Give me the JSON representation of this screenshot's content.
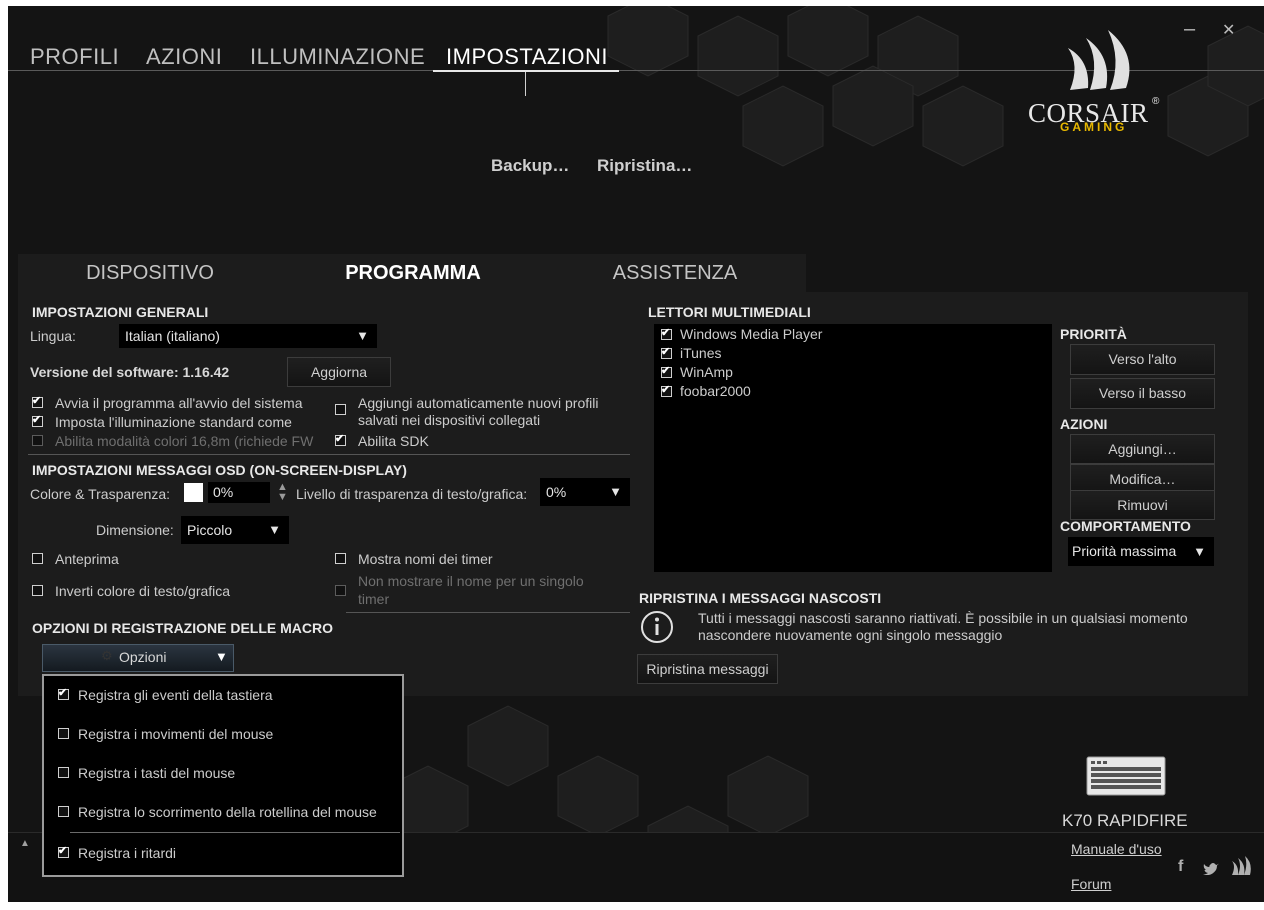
{
  "nav": {
    "tabs": [
      "PROFILI",
      "AZIONI",
      "ILLUMINAZIONE",
      "IMPOSTAZIONI"
    ],
    "minimize": "–",
    "close": "✕"
  },
  "brand": {
    "name": "CORSAIR",
    "sub": "GAMING",
    "mark": "®"
  },
  "header": {
    "backup": "Backup…",
    "restore": "Ripristina…"
  },
  "subtabs": [
    "DISPOSITIVO",
    "PROGRAMMA",
    "ASSISTENZA"
  ],
  "general": {
    "title": "IMPOSTAZIONI GENERALI",
    "language_label": "Lingua:",
    "language_value": "Italian (italiano)",
    "version_label": "Versione del software: 1.16.42",
    "update_button": "Aggiorna",
    "options": [
      {
        "label": "Avvia il programma all'avvio del sistema",
        "checked": true,
        "enabled": true
      },
      {
        "label": "Imposta l'illuminazione standard come",
        "checked": true,
        "enabled": true
      },
      {
        "label": "Abilita modalità colori 16,8m (richiede FW",
        "checked": false,
        "enabled": false
      },
      {
        "label": "Aggiungi automaticamente nuovi profili",
        "label2": "salvati nei dispositivi collegati",
        "checked": false,
        "enabled": true
      },
      {
        "label": "Abilita SDK",
        "checked": true,
        "enabled": true
      }
    ]
  },
  "osd": {
    "title": "IMPOSTAZIONI MESSAGGI OSD (ON-SCREEN-DISPLAY)",
    "color_label": "Colore & Trasparenza:",
    "color_swatch": "#ffffff",
    "transparency_value": "0%",
    "level_label": "Livello di trasparenza di testo/grafica:",
    "level_value": "0%",
    "size_label": "Dimensione:",
    "size_value": "Piccolo",
    "preview": "Anteprima",
    "show_timer_names": "Mostra nomi dei timer",
    "invert": "Inverti colore di testo/grafica",
    "no_single_timer_1": "Non mostrare il nome per un singolo",
    "no_single_timer_2": "timer"
  },
  "macro": {
    "title": "OPZIONI DI REGISTRAZIONE DELLE MACRO",
    "options_button": "Opzioni",
    "menu": [
      {
        "label": "Registra gli eventi della tastiera",
        "checked": true
      },
      {
        "label": "Registra i movimenti del mouse",
        "checked": false
      },
      {
        "label": "Registra i tasti del mouse",
        "checked": false
      },
      {
        "label": "Registra lo scorrimento della rotellina del mouse",
        "checked": false
      },
      {
        "label": "Registra i ritardi",
        "checked": true
      }
    ]
  },
  "media": {
    "title": "LETTORI MULTIMEDIALI",
    "players": [
      "Windows Media Player",
      "iTunes",
      "WinAmp",
      "foobar2000"
    ],
    "priority_title": "PRIORITÀ",
    "up": "Verso l'alto",
    "down": "Verso il basso",
    "actions_title": "AZIONI",
    "add": "Aggiungi…",
    "edit": "Modifica…",
    "remove": "Rimuovi",
    "behavior_title": "COMPORTAMENTO",
    "behavior_value": "Priorità massima"
  },
  "hidden": {
    "title": "RIPRISTINA I MESSAGGI NASCOSTI",
    "text1": "Tutti i messaggi nascosti saranno riattivati. È possibile in un qualsiasi momento",
    "text2": "nascondere nuovamente ogni singolo messaggio",
    "button": "Ripristina messaggi"
  },
  "footer": {
    "device": "K70 RAPIDFIRE",
    "manual": "Manuale d'uso",
    "forum": "Forum",
    "facebook": "f",
    "twitter": "🐦",
    "up_arrow": "▲"
  },
  "colors": {
    "accent": "#e8b800",
    "background": "#141414",
    "panel": "#1c1c1c"
  }
}
